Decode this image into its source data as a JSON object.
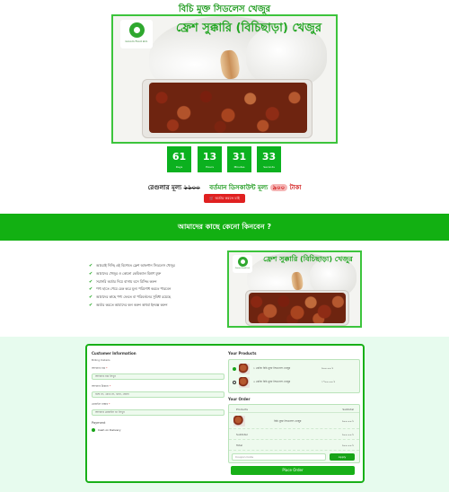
{
  "page": {
    "headline": "বিচি মুক্ত সিডলেস খেজুর"
  },
  "hero": {
    "title": "ফ্রেশ সুক্কারি (বিচিছাড়া) খেজুর",
    "logo_text": "Groom Food Ltd."
  },
  "countdown": [
    {
      "value": "61",
      "label": "Days"
    },
    {
      "value": "13",
      "label": "Hours"
    },
    {
      "value": "31",
      "label": "Minutes"
    },
    {
      "value": "33",
      "label": "Seconds"
    }
  ],
  "prices": {
    "regular_label": "রেগুলার মূল্য",
    "regular_amount": "১১০০",
    "sale_label": "বর্তমান ডিসকাউন্ট মূল্য",
    "sale_amount": "৯০০",
    "unit": "টাকা"
  },
  "cta": {
    "order_button": "অর্ডার করতে চাই"
  },
  "why_section": {
    "title": "আমাদের কাছে কেনো কিনবেন ?",
    "features": [
      "আমরাই দিচ্ছি এই বিশেষত ফ্রেশ আফগান সিডলেস খেজুর",
      "আমাদের খেজুর ও কোনো কেমিক্যাল মিশ্রণ মুক্ত",
      "সরাসরি অর্ডার দিয়ে বাসায় বসে রিসিভ করুন",
      "পণ্য হাতে পেয়ে চেক করে মূল্য পরিশোধ করতে পারবেন",
      "আমাদের কাছে পণ্য ফেরত বা পরিবর্তনের সুবিধা রয়েছে",
      "অর্ডার করতে আমাদের কল করুন অথবা ইনবক্স করুন"
    ]
  },
  "checkout": {
    "customer_title": "Customer Information",
    "billing_title": "Billing Details",
    "fields": [
      {
        "label": "আপনার নাম",
        "placeholder": "আপনার নাম লিখুন"
      },
      {
        "label": "আপনার ঠিকানা",
        "placeholder": "বাসা নং, রোড নং, থানা, জেলা"
      },
      {
        "label": "মোবাইল নাম্বার",
        "placeholder": "আপনার মোবাইল নং লিখুন"
      }
    ],
    "payment_title": "Payment",
    "payment_option": "Cash on Delivery",
    "products_title": "Your Products",
    "products": [
      {
        "name": "১ কেজি বিচি মুক্ত সিডলেস খেজুর",
        "price": "৯০০.০০ ৳",
        "selected": true
      },
      {
        "name": "২ কেজি বিচি মুক্ত সিডলেস খেজুর",
        "price": "১৭০০.০০ ৳",
        "selected": false
      }
    ],
    "order_title": "Your Order",
    "order_head_product": "Products",
    "order_head_subtotal": "Subtotal",
    "order_item_name": "বিচি মুক্ত সিডলেস খেজুর",
    "order_item_price": "৯০০.০০ ৳",
    "subtotal_label": "Subtotal",
    "subtotal_value": "৯০০.০০ ৳",
    "total_label": "Total",
    "total_value": "৯০০.০০ ৳",
    "coupon_placeholder": "Coupon Code",
    "apply_label": "Apply",
    "place_order_label": "Place Order"
  },
  "colors": {
    "brand_green": "#12b012",
    "accent_red": "#e02020",
    "checkout_bg": "#e7fbee"
  }
}
